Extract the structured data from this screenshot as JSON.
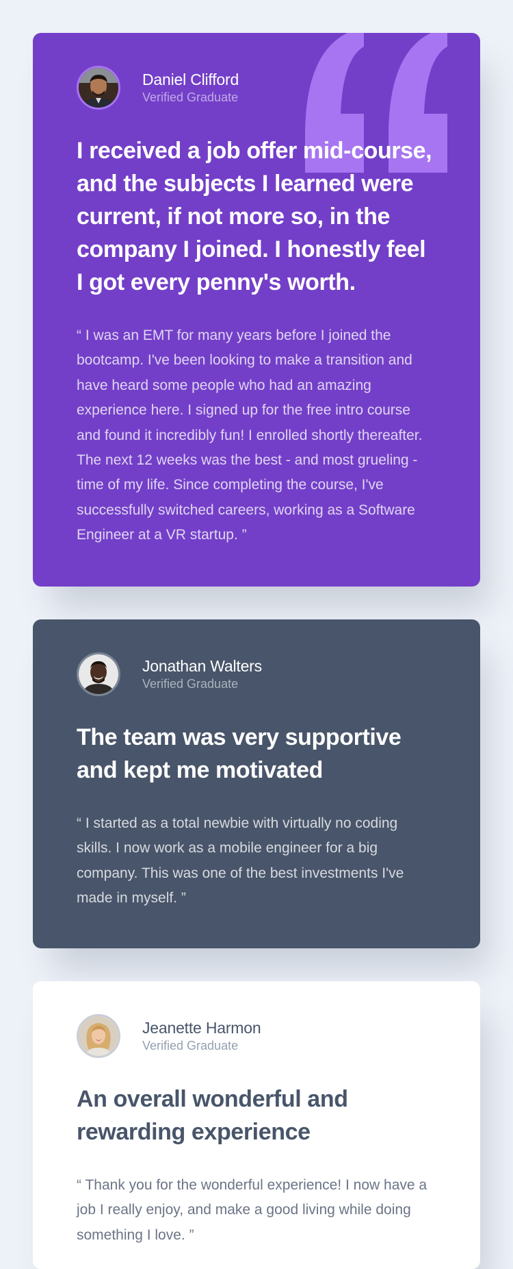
{
  "colors": {
    "page_background": "#edf1f8",
    "card_purple": "#733fc8",
    "card_slate": "#48556a",
    "card_white": "#ffffff",
    "quote_mark": "#a775f1"
  },
  "testimonials": [
    {
      "name": "Daniel Clifford",
      "role": "Verified Graduate",
      "avatar_icon": "avatar-daniel-clifford",
      "headline": "I received a job offer mid-course, and the subjects I learned were current, if not more so, in the company I joined. I honestly feel I got every penny's worth.",
      "body": "“ I was an EMT for many years before I joined the bootcamp. I've been looking to make a transition and have heard some people who had an amazing experience here. I signed up for the free intro course and found it incredibly fun! I enrolled shortly thereafter. The next 12 weeks was the best - and most grueling - time of my life. Since completing the course, I've successfully switched careers, working as a Software Engineer at a VR startup. ”"
    },
    {
      "name": "Jonathan Walters",
      "role": "Verified Graduate",
      "avatar_icon": "avatar-jonathan-walters",
      "headline": "The team was very supportive and kept me motivated",
      "body": "“ I started as a total newbie with virtually no coding skills. I now work as a mobile engineer for a big company. This was one of the best investments I've made in myself. ”"
    },
    {
      "name": "Jeanette Harmon",
      "role": "Verified Graduate",
      "avatar_icon": "avatar-jeanette-harmon",
      "headline": "An overall wonderful and rewarding experience",
      "body": "“ Thank you for the wonderful experience! I now have a job I really enjoy, and make a good living while doing something I love. ”"
    }
  ]
}
